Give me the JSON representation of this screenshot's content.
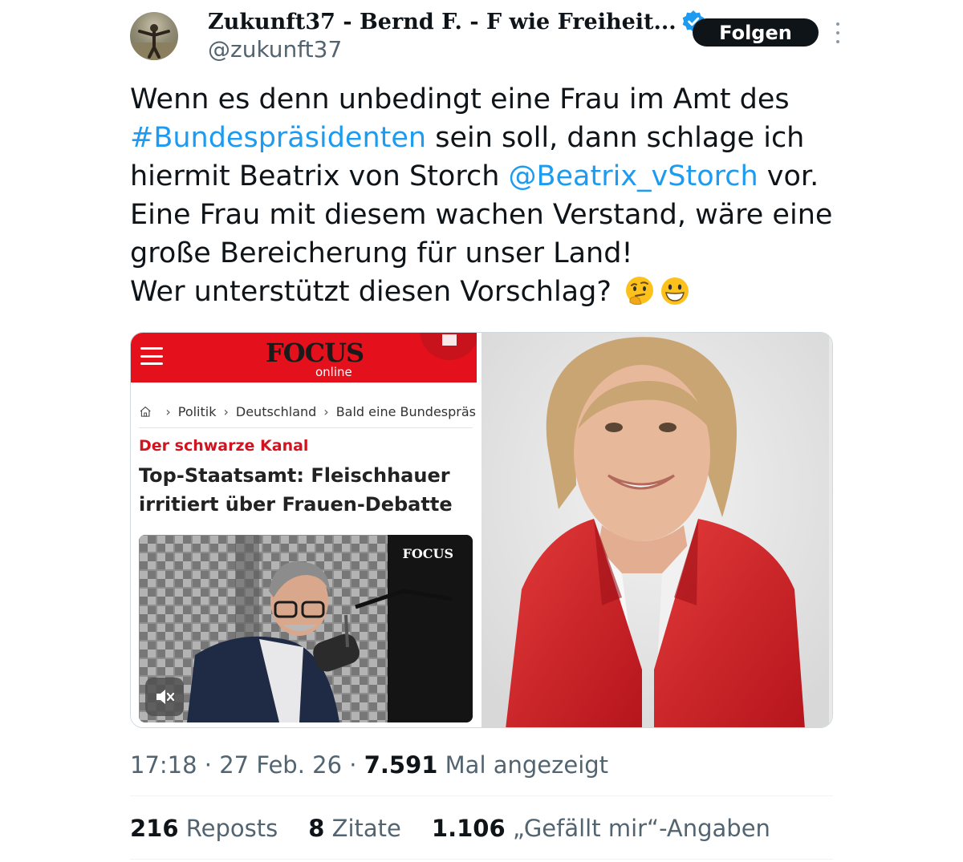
{
  "author": {
    "display_name": "Zukunft37 - Bernd F. - F wie Freiheit...",
    "handle": "@zukunft37",
    "follow_label": "Folgen"
  },
  "tweet": {
    "line1": "Wenn es denn unbedingt eine Frau im Amt des",
    "hashtag": "#Bundespräsidenten",
    "line2_rest": " sein soll, dann schlage ich",
    "line3_start": "hiermit Beatrix von Storch ",
    "mention": "@Beatrix_vStorch",
    "line3_end": " vor.",
    "line4": "Eine Frau mit diesem wachen Verstand, wäre eine",
    "line5": "große Bereicherung für unser Land!",
    "line6": "Wer unterstützt diesen Vorschlag?"
  },
  "media_left": {
    "logo_word": "FOCUS",
    "logo_sub": "online",
    "breadcrumb": [
      "Politik",
      "Deutschland",
      "Bald eine Bundespräs"
    ],
    "kicker": "Der schwarze Kanal",
    "headline_line1": "Top-Staatsamt: Fleischhauer",
    "headline_line2": "irritiert über Frauen-Debatte",
    "video_logo": "FOCUS"
  },
  "meta": {
    "time": "17:18",
    "date": "27 Feb. 26",
    "views_count": "7.591",
    "views_label": "Mal angezeigt"
  },
  "stats": {
    "reposts_count": "216",
    "reposts_label": "Reposts",
    "quotes_count": "8",
    "quotes_label": "Zitate",
    "likes_count": "1.106",
    "likes_label": "„Gefällt mir“-Angaben"
  },
  "colors": {
    "link": "#1d9bf0",
    "focus_red": "#e4101c",
    "text": "#0f1419",
    "muted": "#536471"
  }
}
